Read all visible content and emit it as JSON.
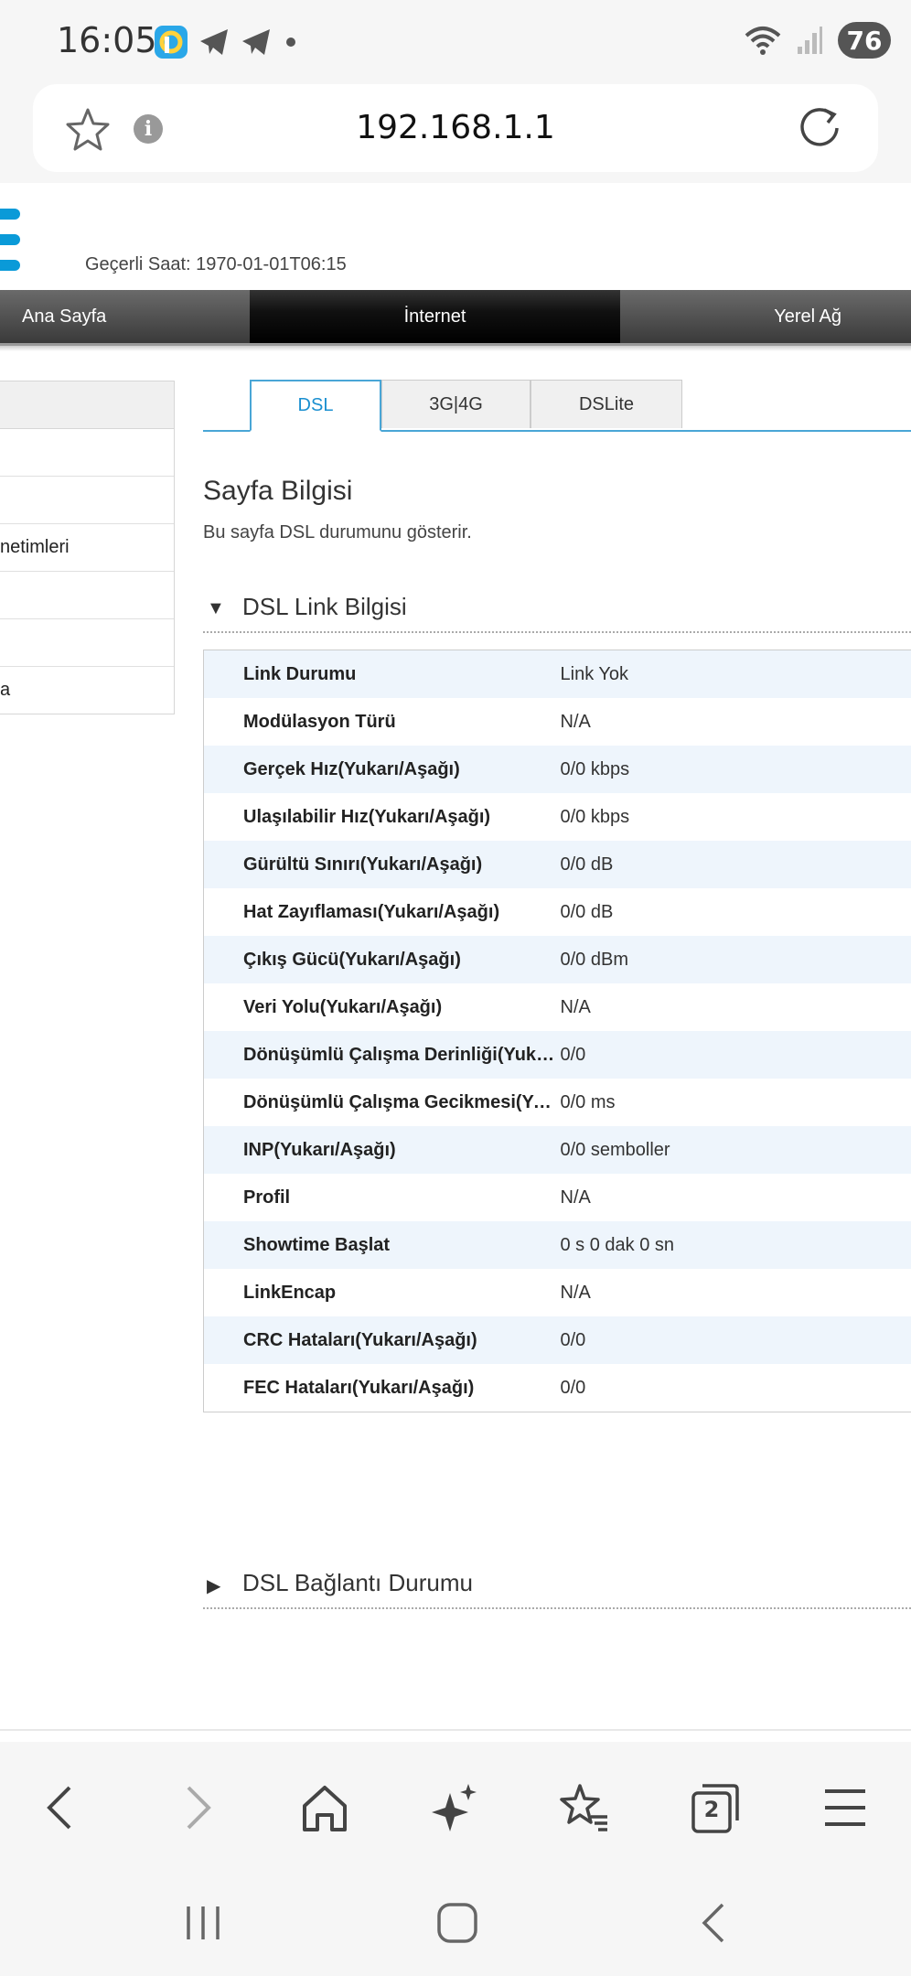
{
  "status_bar": {
    "time": "16:05",
    "icons": [
      "app-icon",
      "telegram-icon",
      "telegram-icon",
      "dot-icon"
    ],
    "battery": "76"
  },
  "browser": {
    "url": "192.168.1.1"
  },
  "router": {
    "clock": "Geçerli Saat: 1970-01-01T06:15",
    "nav": [
      "Ana Sayfa",
      "İnternet",
      "Yerel Ağ"
    ],
    "side_menu": [
      "",
      "",
      "netimleri",
      "",
      "",
      "a"
    ],
    "tabs": [
      "DSL",
      "3G|4G",
      "DSLite"
    ],
    "page_title": "Sayfa Bilgisi",
    "page_desc": "Bu sayfa DSL durumunu gösterir.",
    "section1_title": "DSL Link Bilgisi",
    "section2_title": "DSL Bağlantı Durumu",
    "rows": [
      {
        "k": "Link Durumu",
        "v": "Link Yok"
      },
      {
        "k": "Modülasyon Türü",
        "v": "N/A"
      },
      {
        "k": "Gerçek Hız(Yukarı/Aşağı)",
        "v": "0/0 kbps"
      },
      {
        "k": "Ulaşılabilir Hız(Yukarı/Aşağı)",
        "v": "0/0 kbps"
      },
      {
        "k": "Gürültü Sınırı(Yukarı/Aşağı)",
        "v": "0/0 dB"
      },
      {
        "k": "Hat Zayıflaması(Yukarı/Aşağı)",
        "v": "0/0 dB"
      },
      {
        "k": "Çıkış Gücü(Yukarı/Aşağı)",
        "v": "0/0 dBm"
      },
      {
        "k": "Veri Yolu(Yukarı/Aşağı)",
        "v": "N/A"
      },
      {
        "k": "Dönüşümlü Çalışma Derinliği(Yukarı/A...",
        "v": "0/0"
      },
      {
        "k": "Dönüşümlü Çalışma Gecikmesi(Yukarı/...",
        "v": "0/0 ms"
      },
      {
        "k": "INP(Yukarı/Aşağı)",
        "v": "0/0 semboller"
      },
      {
        "k": "Profil",
        "v": "N/A"
      },
      {
        "k": "Showtime Başlat",
        "v": "0 s 0 dak 0 sn"
      },
      {
        "k": "LinkEncap",
        "v": "N/A"
      },
      {
        "k": "CRC Hataları(Yukarı/Aşağı)",
        "v": "0/0"
      },
      {
        "k": "FEC Hataları(Yukarı/Aşağı)",
        "v": "0/0"
      }
    ]
  },
  "toolbar": {
    "tab_count": "2"
  },
  "colors": {
    "accent": "#49a6d6",
    "logo": "#0a9ad8",
    "row_alt": "#eef5fc"
  }
}
